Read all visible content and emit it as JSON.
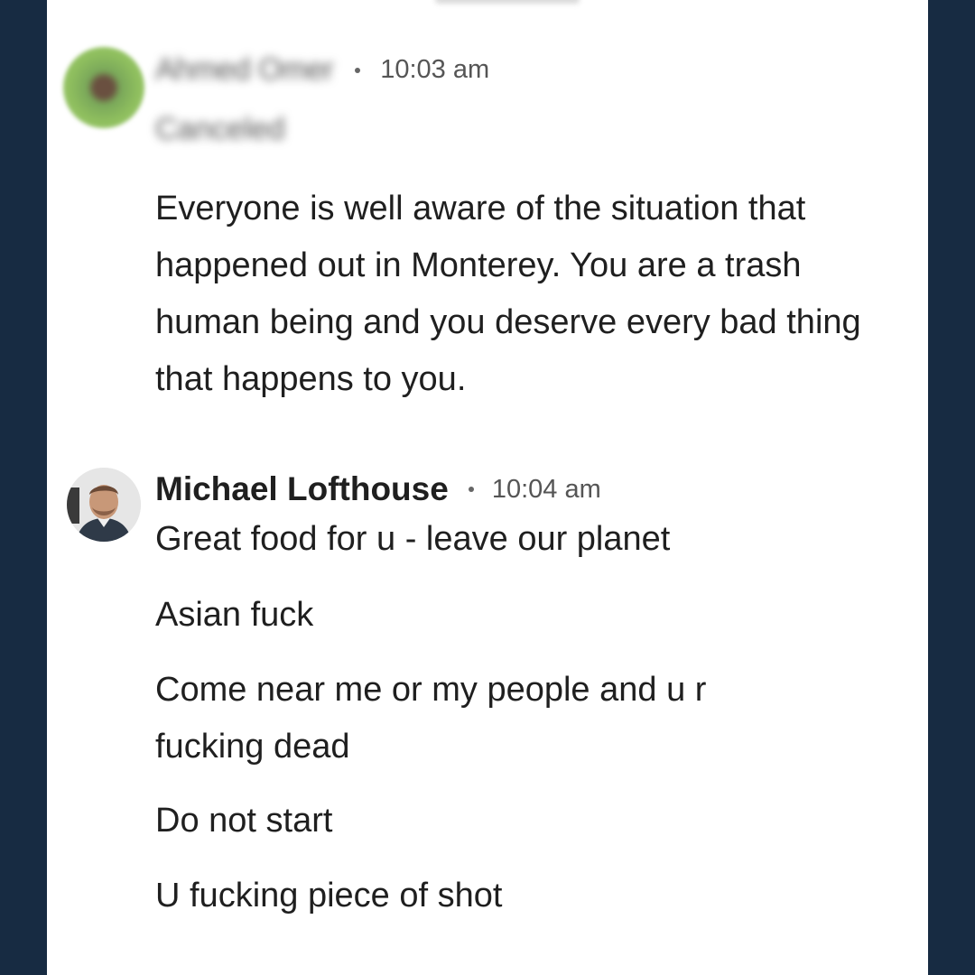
{
  "first_message": {
    "author": "Ahmed Omer",
    "timestamp": "10:03 am",
    "status": "Canceled",
    "body": "Everyone is well aware of the situation that happened out in Monterey. You are a trash human being and you deserve every bad thing that happens to you."
  },
  "second_message": {
    "author": "Michael Lofthouse",
    "timestamp": "10:04 am",
    "lines": [
      "Great food for u - leave our planet",
      "Asian fuck",
      "Come near me or my people and u r",
      "fucking dead",
      "Do not start",
      "U fucking piece of shot"
    ]
  },
  "colors": {
    "background": "#172b42",
    "panel": "#ffffff",
    "text": "#1f1f1f",
    "muted": "#555555"
  }
}
